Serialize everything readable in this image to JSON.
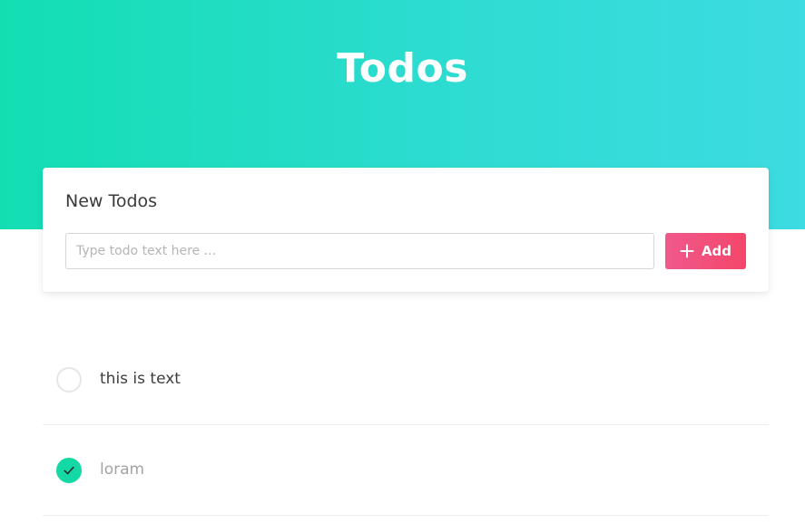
{
  "header": {
    "title": "Todos"
  },
  "new_todo": {
    "heading": "New Todos",
    "placeholder": "Type todo text here ...",
    "value": "",
    "add_label": "Add",
    "add_icon": "plus-icon"
  },
  "colors": {
    "hero_gradient_start": "#13deb2",
    "hero_gradient_end": "#3ddbe2",
    "add_button_start": "#f0598c",
    "add_button_end": "#f4466a",
    "completed_check": "#14d9a4"
  },
  "todos": [
    {
      "text": "this is text",
      "completed": false
    },
    {
      "text": "loram",
      "completed": true
    }
  ]
}
